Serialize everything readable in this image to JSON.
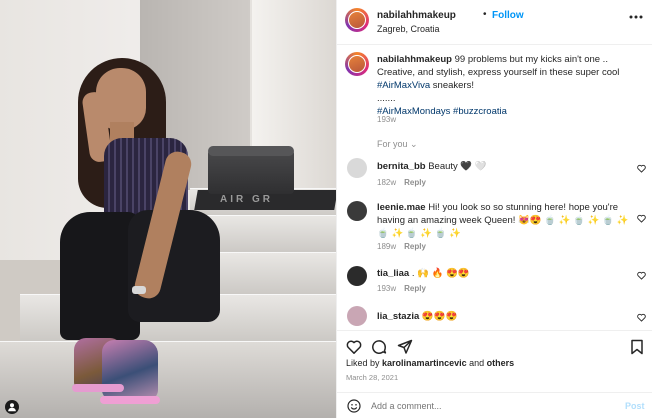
{
  "post": {
    "username": "nabilahhmakeup",
    "follow_dot": "•",
    "follow_label": "Follow",
    "location": "Zagreb, Croatia",
    "more_label": "•••",
    "caption_user": "nabilahhmakeup",
    "caption_text": "99 problems but my kicks ain't one .. Creative, and stylish, express yourself in these super cool",
    "caption_tag1": "#AirMaxViva",
    "caption_after_tag1": " sneakers!",
    "caption_dots": ".......",
    "caption_tag2": "#AirMaxMondays",
    "caption_tag3": "#buzzcroatia",
    "caption_time": "193w",
    "for_you_label": "For you ⌄"
  },
  "comments": [
    {
      "user": "bernita_bb",
      "text": "Beauty 🖤 🤍",
      "time": "182w",
      "reply": "Reply",
      "avatar_color": "#d9d9d9"
    },
    {
      "user": "leenie.mae",
      "text": "Hi! you look so so stunning here! hope you're having an amazing week Queen! 😻😍 🍵 ✨ 🍵 ✨ 🍵 ✨ 🍵 ✨ 🍵 ✨ 🍵 ✨",
      "time": "189w",
      "reply": "Reply",
      "avatar_color": "#3a3a3a"
    },
    {
      "user": "tia_liaa",
      "text": ". 🙌 🔥 😍😍",
      "time": "193w",
      "reply": "Reply",
      "avatar_color": "#2b2b2b"
    },
    {
      "user": "lia_stazia",
      "text": "😍😍😍",
      "time": "",
      "reply": "",
      "avatar_color": "#c9a6b4"
    }
  ],
  "footer": {
    "liked_prefix": "Liked by",
    "liked_user": "karolinamartincevic",
    "liked_and": "and",
    "liked_others": "others",
    "date": "March 28, 2021",
    "add_comment_placeholder": "Add a comment...",
    "post_label": "Post"
  },
  "photo": {
    "mat_text": "AIR GR",
    "user_tag": "👤"
  },
  "colors": {
    "accent": "#0095f6",
    "text": "#262626",
    "muted": "#8e8e8e",
    "hashtag": "#00376b"
  }
}
